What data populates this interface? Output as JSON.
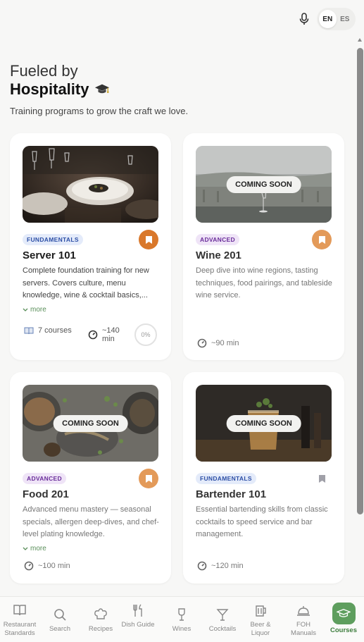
{
  "header": {
    "lang_options": [
      "EN",
      "ES"
    ],
    "active_lang": "EN"
  },
  "hero": {
    "line1": "Fueled by",
    "line2": "Hospitality",
    "subtitle": "Training programs to grow the craft we love."
  },
  "courses": [
    {
      "title": "Server 101",
      "badge": "FUNDAMENTALS",
      "description": "Complete foundation training for new servers. Covers culture, menu knowledge, wine & cocktail basics,...",
      "more_label": "more",
      "courses_count": "7 courses",
      "duration": "~140 min",
      "progress": "0%",
      "coming_soon": false,
      "bookmark_icon": "bookmark-icon"
    },
    {
      "title": "Wine 201",
      "badge": "ADVANCED",
      "description": "Deep dive into wine regions, tasting techniques, food pairings, and tableside wine service.",
      "duration": "~90 min",
      "coming_soon": true,
      "coming_soon_label": "COMING SOON",
      "bookmark_icon": "bookmark-icon"
    },
    {
      "title": "Food 201",
      "badge": "ADVANCED",
      "description": "Advanced menu mastery — seasonal specials, allergen deep-dives, and chef-level plating knowledge.",
      "more_label": "more",
      "duration": "~100 min",
      "coming_soon": true,
      "coming_soon_label": "COMING SOON",
      "bookmark_icon": "bookmark-icon"
    },
    {
      "title": "Bartender 101",
      "badge": "FUNDAMENTALS",
      "description": "Essential bartending skills from classic cocktails to speed service and bar management.",
      "duration": "~120 min",
      "coming_soon": true,
      "coming_soon_label": "COMING SOON",
      "bookmark_icon": "bookmark-icon"
    }
  ],
  "nav": {
    "items": [
      {
        "label": "Restaurant Standards",
        "icon": "book-icon"
      },
      {
        "label": "Search",
        "icon": "search-icon"
      },
      {
        "label": "Recipes",
        "icon": "chef-hat-icon"
      },
      {
        "label": "Dish Guide",
        "icon": "utensils-icon"
      },
      {
        "label": "Wines",
        "icon": "wine-icon"
      },
      {
        "label": "Cocktails",
        "icon": "cocktail-icon"
      },
      {
        "label": "Beer & Liquor",
        "icon": "beer-icon"
      },
      {
        "label": "FOH Manuals",
        "icon": "cloche-icon"
      },
      {
        "label": "Courses",
        "icon": "graduation-cap-icon"
      }
    ],
    "active": "Courses"
  },
  "colors": {
    "accent_green": "#5e9e5e",
    "bookmark_orange": "#d9782b",
    "badge_fundamentals": "#2d4fa6",
    "badge_advanced": "#6a2d9a"
  }
}
